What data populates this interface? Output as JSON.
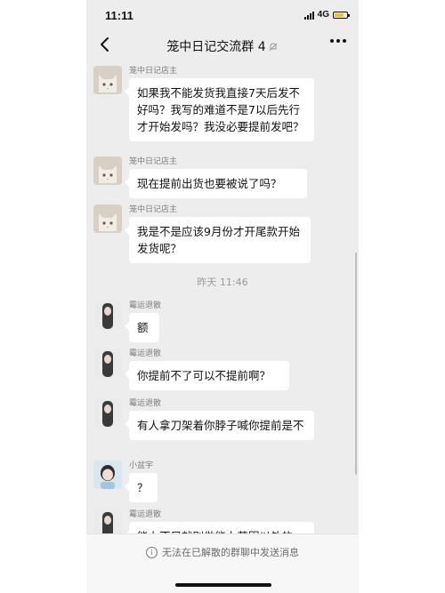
{
  "status_bar": {
    "time": "11:11",
    "network": "4G",
    "battery_level": 0.75,
    "battery_color": "#f3c414"
  },
  "header": {
    "title": "笼中日记交流群 4",
    "back_icon": "chevron-left-icon",
    "mute_icon": "bell-muted-icon",
    "more_icon": "ellipsis-icon"
  },
  "messages": [
    {
      "sender": "笼中日记店主",
      "avatar": "cat-avatar",
      "text": "如果我不能发货我直接7天后发不好吗？我写的难道不是7以后先行才开始发吗？我没必要提前发吧？"
    },
    {
      "sender": "笼中日记店主",
      "avatar": "cat-avatar",
      "text": "现在提前出货也要被说了吗？"
    },
    {
      "sender": "笼中日记店主",
      "avatar": "cat-avatar",
      "text": "我是不是应该9月份才开尾款开始发货呢？"
    },
    {
      "sender": "霉运退散",
      "avatar": "girl-avatar",
      "text": "额"
    },
    {
      "sender": "霉运退散",
      "avatar": "girl-avatar",
      "text": "你提前不了可以不提前啊？"
    },
    {
      "sender": "霉运退散",
      "avatar": "girl-avatar",
      "text": "有人拿刀架着你脖子喊你提前是不"
    },
    {
      "sender": "小盆宇",
      "avatar": "kid-avatar",
      "text": "？"
    },
    {
      "sender": "霉运退散",
      "avatar": "girl-avatar",
      "text": "能力不足就别做能力范围以外的"
    }
  ],
  "timestamp": "昨天 11:46",
  "bottom_notice": {
    "icon": "info-icon",
    "text": "无法在已解散的群聊中发送消息"
  },
  "colors": {
    "chat_background": "#ededed",
    "bubble": "#ffffff"
  }
}
